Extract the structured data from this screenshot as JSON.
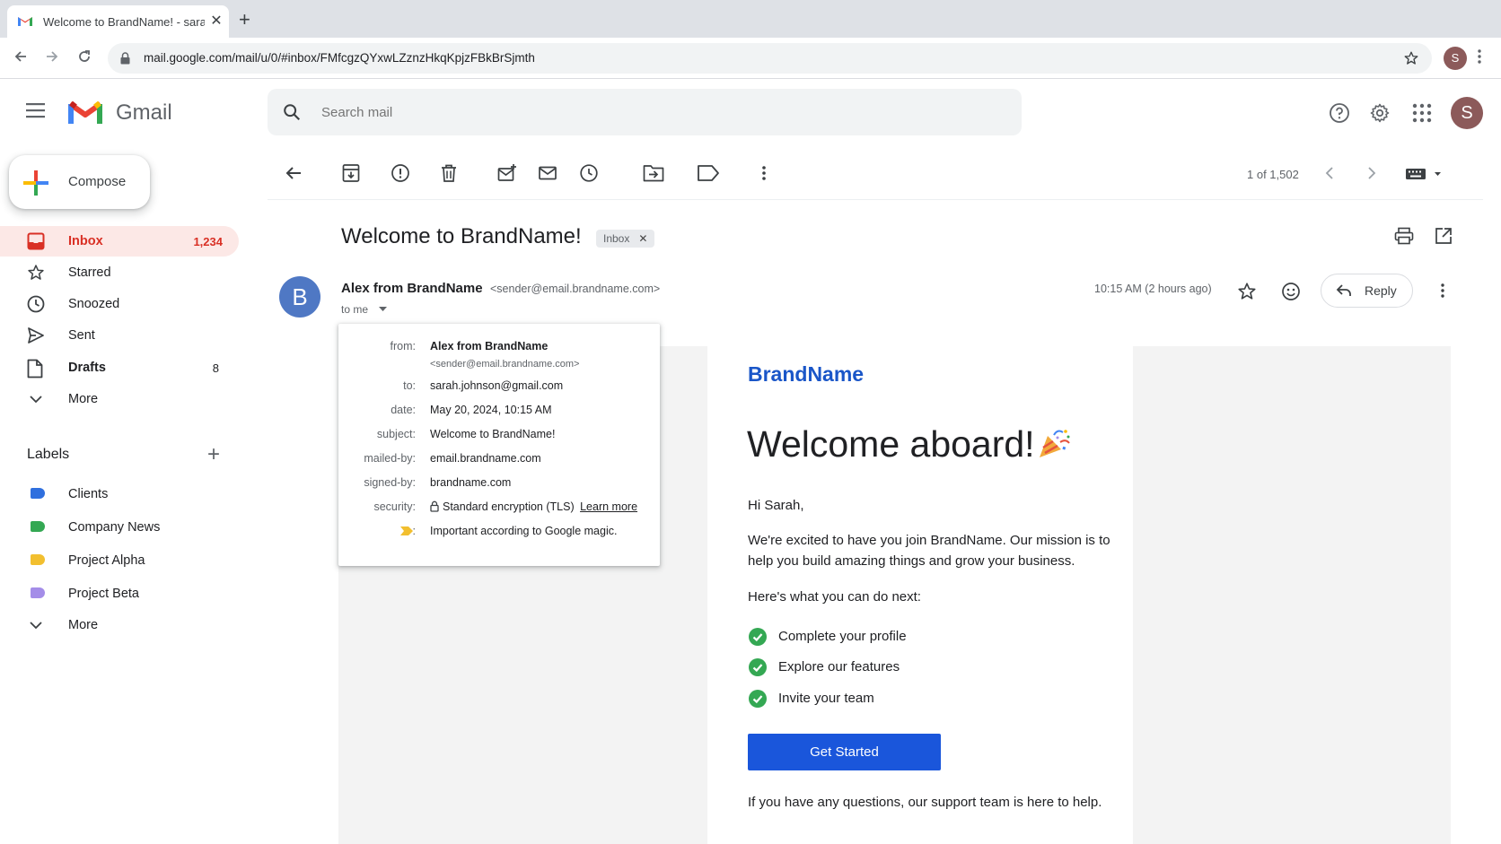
{
  "browser": {
    "tab_title": "Welcome to BrandName! - sarah",
    "url": "mail.google.com/mail/u/0/#inbox/FMfcgzQYxwLZznzHkqKpjzFBkBrSjmth",
    "avatar_letter": "S"
  },
  "gmail": {
    "app_name": "Gmail",
    "search_placeholder": "Search mail",
    "user_initial": "S"
  },
  "sidebar": {
    "compose_label": "Compose",
    "items": [
      {
        "label": "Inbox",
        "count": "1,234",
        "icon": "inbox-icon",
        "active": true
      },
      {
        "label": "Starred",
        "count": "",
        "icon": "star-icon"
      },
      {
        "label": "Snoozed",
        "count": "",
        "icon": "clock-icon"
      },
      {
        "label": "Sent",
        "count": "",
        "icon": "send-icon"
      },
      {
        "label": "Drafts",
        "count": "8",
        "icon": "draft-icon"
      },
      {
        "label": "More",
        "count": "",
        "icon": "chevron-down-icon"
      }
    ],
    "labels_title": "Labels",
    "labels": [
      {
        "label": "Clients",
        "color": "#2f6fde"
      },
      {
        "label": "Company News",
        "color": "#34a853"
      },
      {
        "label": "Project Alpha",
        "color": "#f2bf2f"
      },
      {
        "label": "Project Beta",
        "color": "#a48de8"
      }
    ],
    "labels_more": "More"
  },
  "toolbar": {
    "pager": "1 of 1,502"
  },
  "message": {
    "subject": "Welcome to BrandName!",
    "chip": "Inbox",
    "sender_initial": "B",
    "sender_name": "Alex from BrandName",
    "sender_email": "<sender@email.brandname.com>",
    "to": "to me",
    "time": "10:15 AM (2 hours ago)",
    "reply_label": "Reply"
  },
  "details": {
    "from_key": "from:",
    "from_name": "Alex from BrandName",
    "from_email": "<sender@email.brandname.com>",
    "to_key": "to:",
    "to_val": "sarah.johnson@gmail.com",
    "date_key": "date:",
    "date_val": "May 20, 2024, 10:15 AM",
    "subject_key": "subject:",
    "subject_val": "Welcome to BrandName!",
    "mailedby_key": "mailed-by:",
    "mailedby_val": "email.brandname.com",
    "signedby_key": "signed-by:",
    "signedby_val": "brandname.com",
    "security_key": "security:",
    "security_val": "Standard encryption (TLS)",
    "security_link": "Learn more",
    "important_key": ":",
    "important_val": "Important according to Google magic."
  },
  "email": {
    "brand": "BrandName",
    "headline": "Welcome aboard!",
    "greeting": "Hi Sarah,",
    "intro": "We're excited to have you join BrandName. Our mission is to help you build amazing things and grow your business.",
    "next_title": "Here's what you can do next:",
    "checklist": [
      "Complete your profile",
      "Explore our features",
      "Invite your team"
    ],
    "cta": "Get Started",
    "footer": "If you have any questions, our support team is here to help."
  },
  "colors": {
    "accent_red": "#d93025",
    "brand_blue": "#1a56c8",
    "cta_blue": "#1a56db",
    "check_green": "#34a853"
  }
}
